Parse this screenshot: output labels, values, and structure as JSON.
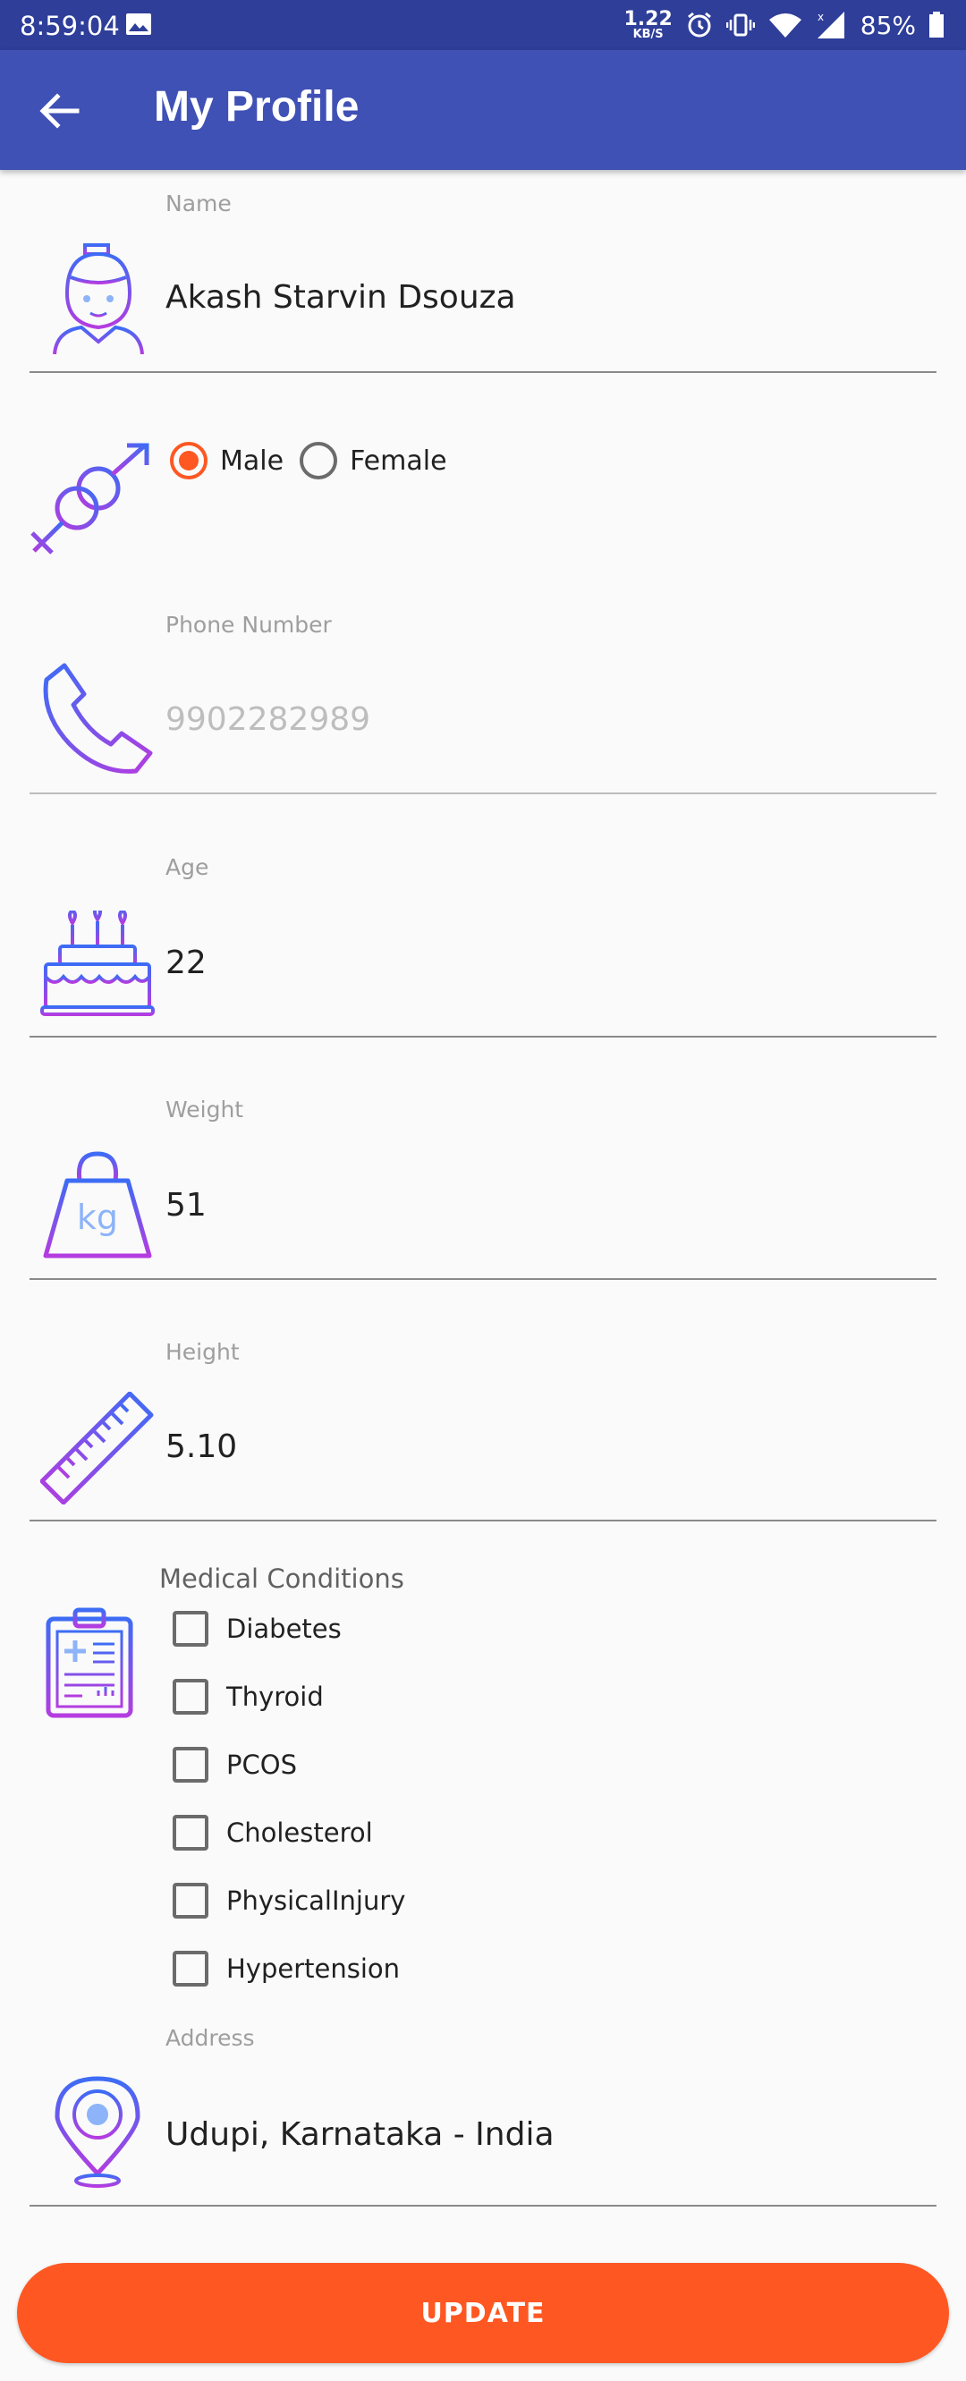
{
  "status_bar": {
    "time": "8:59:04",
    "speed_value": "1.22",
    "speed_unit": "KB/S",
    "battery": "85%"
  },
  "app_bar": {
    "title": "My Profile"
  },
  "name": {
    "label": "Name",
    "value": "Akash Starvin Dsouza"
  },
  "gender": {
    "options": [
      "Male",
      "Female"
    ],
    "selected": "Male"
  },
  "phone": {
    "label": "Phone Number",
    "value": "9902282989"
  },
  "age": {
    "label": "Age",
    "value": "22"
  },
  "weight": {
    "label": "Weight",
    "value": "51",
    "icon_text": "kg"
  },
  "height": {
    "label": "Height",
    "value": "5.10"
  },
  "medical": {
    "title": "Medical Conditions",
    "conditions": [
      "Diabetes",
      "Thyroid",
      "PCOS",
      "Cholesterol",
      "PhysicalInjury",
      "Hypertension"
    ]
  },
  "address": {
    "label": "Address",
    "value": "Udupi, Karnataka - India"
  },
  "update_button": {
    "label": "UPDATE"
  },
  "colors": {
    "primary": "#3f51b5",
    "primary_dark": "#2e3e99",
    "accent": "#ff5722"
  }
}
